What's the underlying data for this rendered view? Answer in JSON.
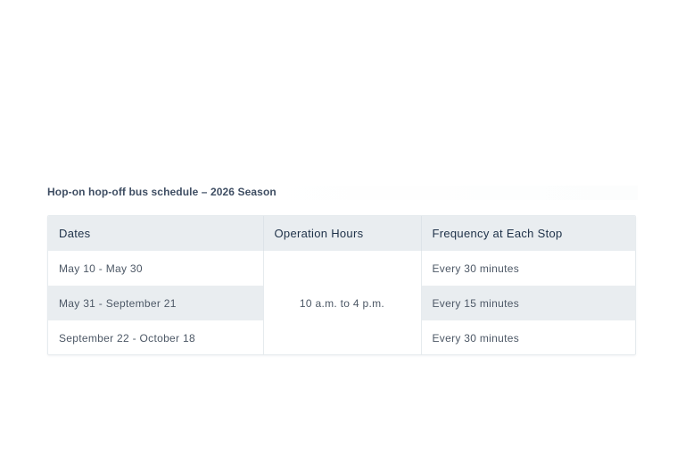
{
  "caption": "Hop-on hop-off bus schedule – 2026 Season",
  "table": {
    "headers": [
      "Dates",
      "Operation Hours",
      "Frequency at Each Stop"
    ],
    "rows": [
      {
        "dates": "May 10 - May 30",
        "frequency": "Every 30 minutes"
      },
      {
        "dates": "May 31 - September 21",
        "frequency": "Every 15 minutes"
      },
      {
        "dates": "September 22 - October 18",
        "frequency": "Every 30 minutes"
      }
    ],
    "operation_hours": "10 a.m. to 4 p.m."
  },
  "colors": {
    "header_bg": "#e9edf0",
    "stripe_bg": "#e9edf0",
    "heading_text": "#1e3148",
    "body_text": "#4d5866"
  }
}
